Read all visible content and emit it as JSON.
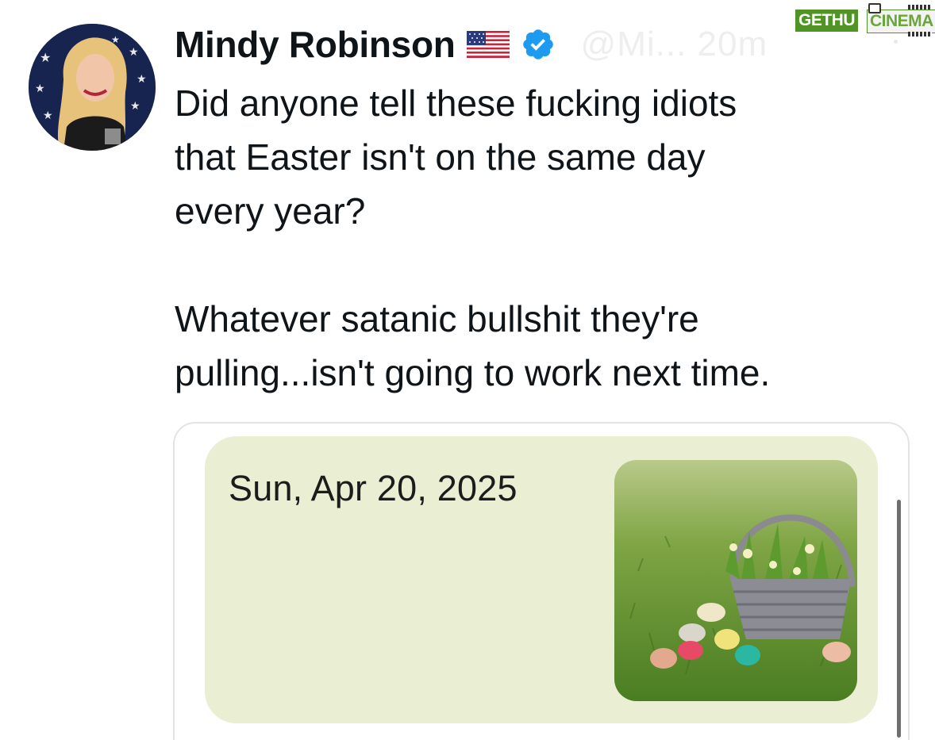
{
  "header": {
    "display_name": "Mindy Robinson",
    "flag_icon": "us-flag-icon",
    "verified_icon": "verified-badge-icon",
    "faded_handle": "@Mi... 20m"
  },
  "watermark": {
    "left": "GETHU",
    "right": "CINEMA"
  },
  "tweet": {
    "line1": "Did anyone tell these fucking idiots",
    "line2": "that Easter isn't on the same day",
    "line3": "every year?",
    "line4": "Whatever satanic bullshit they're",
    "line5": "pulling...isn't going to work next time."
  },
  "card": {
    "date": "Sun, Apr 20, 2025",
    "image_icon": "easter-basket-photo"
  },
  "colors": {
    "verified_blue": "#1d9bf0",
    "card_background": "#eaeed3",
    "watermark_green": "#4f9424"
  }
}
